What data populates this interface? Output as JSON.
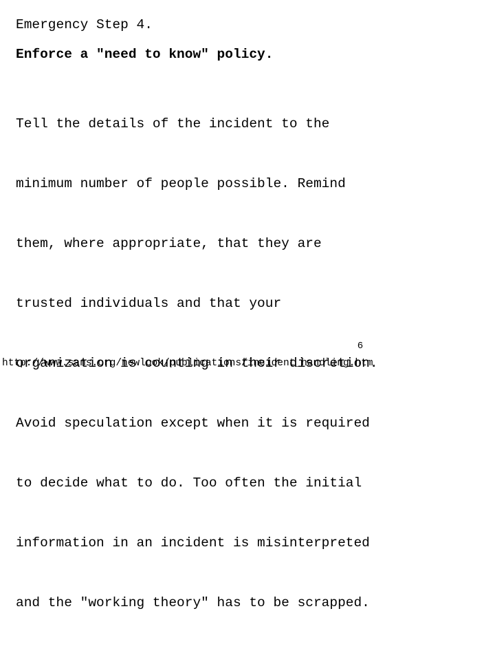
{
  "slide": {
    "title": "Emergency Step 4.",
    "subtitle": "Enforce a \"need to know\" policy.",
    "body_lines": [
      "Tell the details of the incident to the",
      "minimum number of people possible. Remind",
      "them, where appropriate, that they are",
      "trusted individuals and that your",
      "organization is counting in their discretion.",
      "Avoid speculation except when it is required",
      "to decide what to do. Too often the initial",
      "information in an incident is misinterpreted",
      "and the \"working theory\" has to be scrapped."
    ],
    "body_text": "Tell the details of the incident to the minimum number of people possible. Remind them, where appropriate, that they are trusted individuals and that your organization is counting in their discretion. Avoid speculation except when it is required to decide what to do. Too often the initial information in an incident is misinterpreted and the \"working theory\" has to be scrapped."
  },
  "footer": {
    "page_number": "6",
    "url": "http://www.sans.org/newlook/publications/incident_handling.htm"
  },
  "colors": {
    "background": "#ffffff",
    "text": "#000000"
  }
}
